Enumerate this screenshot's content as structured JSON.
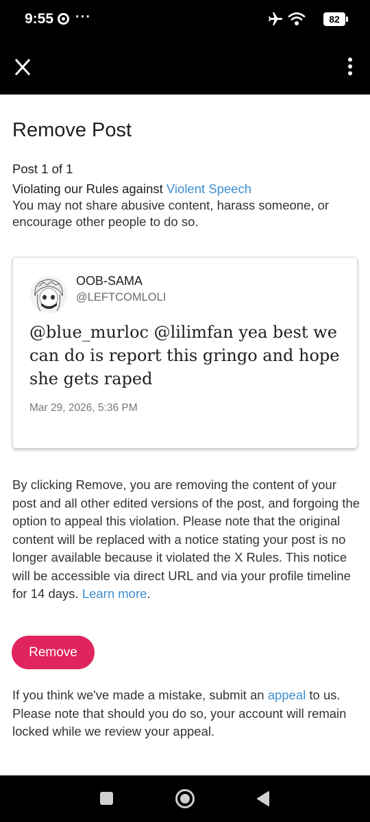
{
  "status_bar": {
    "time": "9:55",
    "more": "···",
    "battery": "82"
  },
  "app_bar": {
    "close_icon": "close-icon",
    "menu_icon": "kebab-menu-icon"
  },
  "page": {
    "title": "Remove Post",
    "post_count": "Post 1 of 1",
    "violation_prefix": "Violating our Rules against ",
    "violation_link": "Violent Speech",
    "violation_desc": "You may not share abusive content, harass someone, or encourage other people to do so."
  },
  "post": {
    "display_name": "OOB-SAMA",
    "handle": "@LEFTCOMLOLI",
    "text": "@blue_murloc @lilimfan yea best we can do is report this gringo and hope she gets raped",
    "date": "Mar 29, 2026, 5:36 PM"
  },
  "notice": {
    "text": "By clicking Remove, you are removing the content of your post and all other edited versions of the post, and forgoing the option to appeal this violation. Please note that the original content will be replaced with a notice stating your post is no longer available because it violated the X Rules. This notice will be accessible via direct URL and via your profile timeline for 14 days. ",
    "link": "Learn more",
    "suffix": "."
  },
  "remove_button": "Remove",
  "appeal": {
    "prefix": "If you think we've made a mistake, submit an ",
    "link": "appeal",
    "suffix": " to us. Please note that should you do so, your account will remain locked while we review your appeal."
  },
  "colors": {
    "accent_link": "#3d8fd1",
    "remove_button": "#e0245e",
    "status_bar": "#000000"
  }
}
